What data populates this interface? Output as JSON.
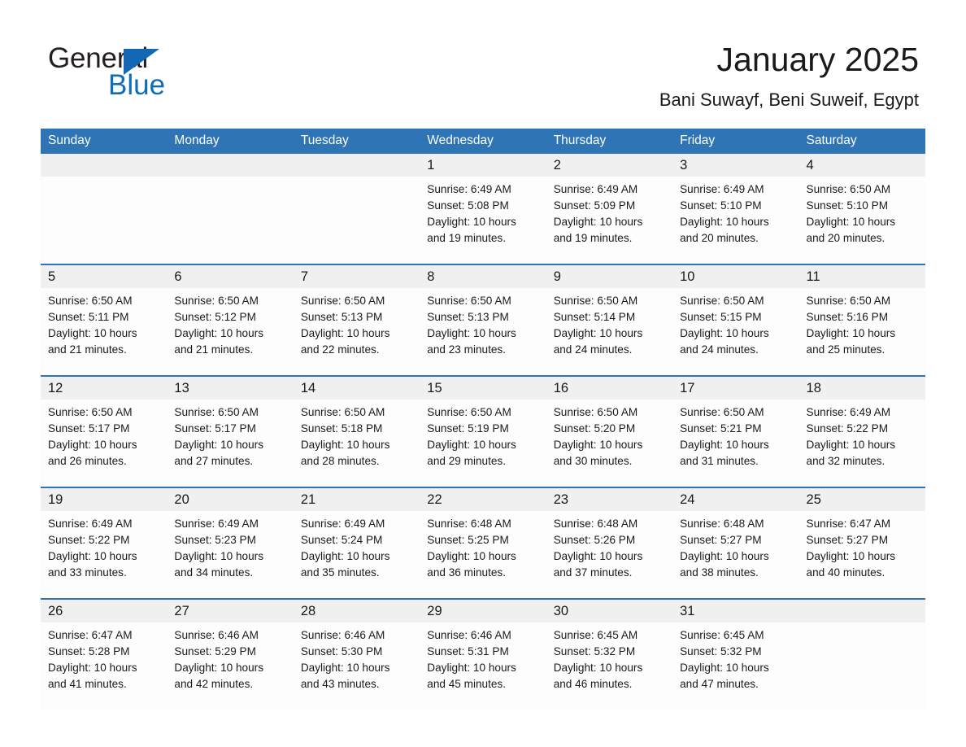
{
  "brand": {
    "name_part1": "General",
    "name_part2": "Blue",
    "accent_color": "#1268b3"
  },
  "header": {
    "title": "January 2025",
    "location": "Bani Suwayf, Beni Suweif, Egypt"
  },
  "theme": {
    "header_blue": "#2f74b5",
    "daynum_band": "#f0f0f0",
    "cell_bg": "#fdfdfd",
    "text": "#1a1a1a"
  },
  "weekday_headers": [
    "Sunday",
    "Monday",
    "Tuesday",
    "Wednesday",
    "Thursday",
    "Friday",
    "Saturday"
  ],
  "weeks": [
    [
      {
        "empty": true
      },
      {
        "empty": true
      },
      {
        "empty": true
      },
      {
        "day": "1",
        "sunrise": "Sunrise: 6:49 AM",
        "sunset": "Sunset: 5:08 PM",
        "daylight1": "Daylight: 10 hours",
        "daylight2": "and 19 minutes."
      },
      {
        "day": "2",
        "sunrise": "Sunrise: 6:49 AM",
        "sunset": "Sunset: 5:09 PM",
        "daylight1": "Daylight: 10 hours",
        "daylight2": "and 19 minutes."
      },
      {
        "day": "3",
        "sunrise": "Sunrise: 6:49 AM",
        "sunset": "Sunset: 5:10 PM",
        "daylight1": "Daylight: 10 hours",
        "daylight2": "and 20 minutes."
      },
      {
        "day": "4",
        "sunrise": "Sunrise: 6:50 AM",
        "sunset": "Sunset: 5:10 PM",
        "daylight1": "Daylight: 10 hours",
        "daylight2": "and 20 minutes."
      }
    ],
    [
      {
        "day": "5",
        "sunrise": "Sunrise: 6:50 AM",
        "sunset": "Sunset: 5:11 PM",
        "daylight1": "Daylight: 10 hours",
        "daylight2": "and 21 minutes."
      },
      {
        "day": "6",
        "sunrise": "Sunrise: 6:50 AM",
        "sunset": "Sunset: 5:12 PM",
        "daylight1": "Daylight: 10 hours",
        "daylight2": "and 21 minutes."
      },
      {
        "day": "7",
        "sunrise": "Sunrise: 6:50 AM",
        "sunset": "Sunset: 5:13 PM",
        "daylight1": "Daylight: 10 hours",
        "daylight2": "and 22 minutes."
      },
      {
        "day": "8",
        "sunrise": "Sunrise: 6:50 AM",
        "sunset": "Sunset: 5:13 PM",
        "daylight1": "Daylight: 10 hours",
        "daylight2": "and 23 minutes."
      },
      {
        "day": "9",
        "sunrise": "Sunrise: 6:50 AM",
        "sunset": "Sunset: 5:14 PM",
        "daylight1": "Daylight: 10 hours",
        "daylight2": "and 24 minutes."
      },
      {
        "day": "10",
        "sunrise": "Sunrise: 6:50 AM",
        "sunset": "Sunset: 5:15 PM",
        "daylight1": "Daylight: 10 hours",
        "daylight2": "and 24 minutes."
      },
      {
        "day": "11",
        "sunrise": "Sunrise: 6:50 AM",
        "sunset": "Sunset: 5:16 PM",
        "daylight1": "Daylight: 10 hours",
        "daylight2": "and 25 minutes."
      }
    ],
    [
      {
        "day": "12",
        "sunrise": "Sunrise: 6:50 AM",
        "sunset": "Sunset: 5:17 PM",
        "daylight1": "Daylight: 10 hours",
        "daylight2": "and 26 minutes."
      },
      {
        "day": "13",
        "sunrise": "Sunrise: 6:50 AM",
        "sunset": "Sunset: 5:17 PM",
        "daylight1": "Daylight: 10 hours",
        "daylight2": "and 27 minutes."
      },
      {
        "day": "14",
        "sunrise": "Sunrise: 6:50 AM",
        "sunset": "Sunset: 5:18 PM",
        "daylight1": "Daylight: 10 hours",
        "daylight2": "and 28 minutes."
      },
      {
        "day": "15",
        "sunrise": "Sunrise: 6:50 AM",
        "sunset": "Sunset: 5:19 PM",
        "daylight1": "Daylight: 10 hours",
        "daylight2": "and 29 minutes."
      },
      {
        "day": "16",
        "sunrise": "Sunrise: 6:50 AM",
        "sunset": "Sunset: 5:20 PM",
        "daylight1": "Daylight: 10 hours",
        "daylight2": "and 30 minutes."
      },
      {
        "day": "17",
        "sunrise": "Sunrise: 6:50 AM",
        "sunset": "Sunset: 5:21 PM",
        "daylight1": "Daylight: 10 hours",
        "daylight2": "and 31 minutes."
      },
      {
        "day": "18",
        "sunrise": "Sunrise: 6:49 AM",
        "sunset": "Sunset: 5:22 PM",
        "daylight1": "Daylight: 10 hours",
        "daylight2": "and 32 minutes."
      }
    ],
    [
      {
        "day": "19",
        "sunrise": "Sunrise: 6:49 AM",
        "sunset": "Sunset: 5:22 PM",
        "daylight1": "Daylight: 10 hours",
        "daylight2": "and 33 minutes."
      },
      {
        "day": "20",
        "sunrise": "Sunrise: 6:49 AM",
        "sunset": "Sunset: 5:23 PM",
        "daylight1": "Daylight: 10 hours",
        "daylight2": "and 34 minutes."
      },
      {
        "day": "21",
        "sunrise": "Sunrise: 6:49 AM",
        "sunset": "Sunset: 5:24 PM",
        "daylight1": "Daylight: 10 hours",
        "daylight2": "and 35 minutes."
      },
      {
        "day": "22",
        "sunrise": "Sunrise: 6:48 AM",
        "sunset": "Sunset: 5:25 PM",
        "daylight1": "Daylight: 10 hours",
        "daylight2": "and 36 minutes."
      },
      {
        "day": "23",
        "sunrise": "Sunrise: 6:48 AM",
        "sunset": "Sunset: 5:26 PM",
        "daylight1": "Daylight: 10 hours",
        "daylight2": "and 37 minutes."
      },
      {
        "day": "24",
        "sunrise": "Sunrise: 6:48 AM",
        "sunset": "Sunset: 5:27 PM",
        "daylight1": "Daylight: 10 hours",
        "daylight2": "and 38 minutes."
      },
      {
        "day": "25",
        "sunrise": "Sunrise: 6:47 AM",
        "sunset": "Sunset: 5:27 PM",
        "daylight1": "Daylight: 10 hours",
        "daylight2": "and 40 minutes."
      }
    ],
    [
      {
        "day": "26",
        "sunrise": "Sunrise: 6:47 AM",
        "sunset": "Sunset: 5:28 PM",
        "daylight1": "Daylight: 10 hours",
        "daylight2": "and 41 minutes."
      },
      {
        "day": "27",
        "sunrise": "Sunrise: 6:46 AM",
        "sunset": "Sunset: 5:29 PM",
        "daylight1": "Daylight: 10 hours",
        "daylight2": "and 42 minutes."
      },
      {
        "day": "28",
        "sunrise": "Sunrise: 6:46 AM",
        "sunset": "Sunset: 5:30 PM",
        "daylight1": "Daylight: 10 hours",
        "daylight2": "and 43 minutes."
      },
      {
        "day": "29",
        "sunrise": "Sunrise: 6:46 AM",
        "sunset": "Sunset: 5:31 PM",
        "daylight1": "Daylight: 10 hours",
        "daylight2": "and 45 minutes."
      },
      {
        "day": "30",
        "sunrise": "Sunrise: 6:45 AM",
        "sunset": "Sunset: 5:32 PM",
        "daylight1": "Daylight: 10 hours",
        "daylight2": "and 46 minutes."
      },
      {
        "day": "31",
        "sunrise": "Sunrise: 6:45 AM",
        "sunset": "Sunset: 5:32 PM",
        "daylight1": "Daylight: 10 hours",
        "daylight2": "and 47 minutes."
      },
      {
        "empty": true
      }
    ]
  ]
}
